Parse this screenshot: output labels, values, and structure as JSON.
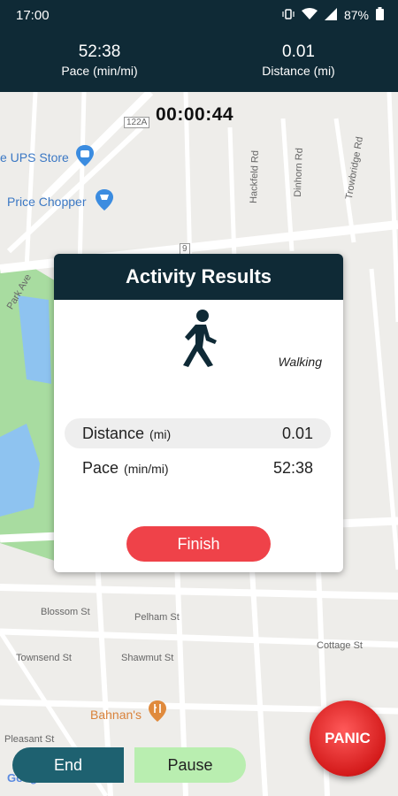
{
  "status_bar": {
    "time": "17:00",
    "battery": "87%"
  },
  "header": {
    "pace": {
      "value": "52:38",
      "label": "Pace (min/mi)"
    },
    "distance": {
      "value": "0.01",
      "label": "Distance (mi)"
    }
  },
  "map": {
    "timer": "00:00:44",
    "labels": {
      "ups": "e UPS Store",
      "price_chopper": "Price Chopper",
      "blossom": "Blossom St",
      "pelham": "Pelham St",
      "townsend": "Townsend St",
      "shawmut": "Shawmut St",
      "bahnans": "Bahnan's",
      "cottage": "Cottage St",
      "pleasant": "Pleasant St",
      "hackfeld": "Hackfeld Rd",
      "dinhorn": "Dinhorn Rd",
      "trowbridge": "Trowbridge Rd",
      "park": "Park Ave",
      "route_122a": "122A",
      "route_9": "9",
      "google": "Google"
    }
  },
  "modal": {
    "title": "Activity Results",
    "activity": "Walking",
    "distance_label": "Distance",
    "distance_unit": "(mi)",
    "distance_value": "0.01",
    "pace_label": "Pace",
    "pace_unit": "(min/mi)",
    "pace_value": "52:38",
    "finish_label": "Finish"
  },
  "controls": {
    "end": "End",
    "pause": "Pause",
    "panic": "PANIC"
  },
  "colors": {
    "header": "#0f2a36",
    "finish": "#ef4249",
    "end": "#1e6170",
    "pause": "#b9eeb0",
    "panic": "#d41b1b",
    "park": "#a8dca0",
    "water": "#8ec3f0"
  }
}
